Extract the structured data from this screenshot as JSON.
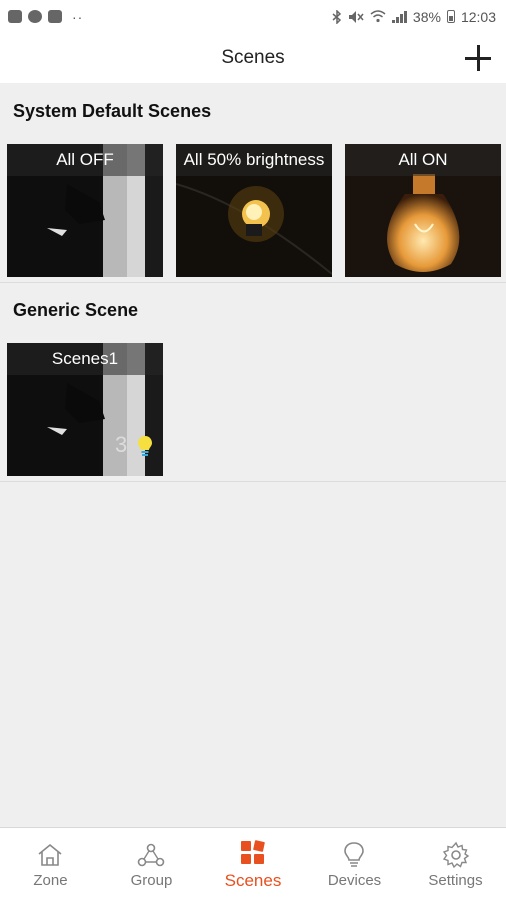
{
  "status_bar": {
    "battery": "38%",
    "time": "12:03"
  },
  "header": {
    "title": "Scenes",
    "add_icon": "plus-icon"
  },
  "system_section": {
    "title": "System Default Scenes",
    "scenes": [
      {
        "label": "All OFF"
      },
      {
        "label": "All 50% brightness"
      },
      {
        "label": "All ON"
      }
    ]
  },
  "generic_section": {
    "title": "Generic Scene",
    "scenes": [
      {
        "label": "Scenes1",
        "device_count": "3",
        "icon": "bulb-icon"
      }
    ]
  },
  "bottom_nav": {
    "active_color": "#e8501f",
    "items": [
      {
        "label": "Zone",
        "icon": "home-icon"
      },
      {
        "label": "Group",
        "icon": "group-icon"
      },
      {
        "label": "Scenes",
        "icon": "scenes-grid-icon",
        "active": true
      },
      {
        "label": "Devices",
        "icon": "bulb-outline-icon"
      },
      {
        "label": "Settings",
        "icon": "gear-icon"
      }
    ]
  }
}
